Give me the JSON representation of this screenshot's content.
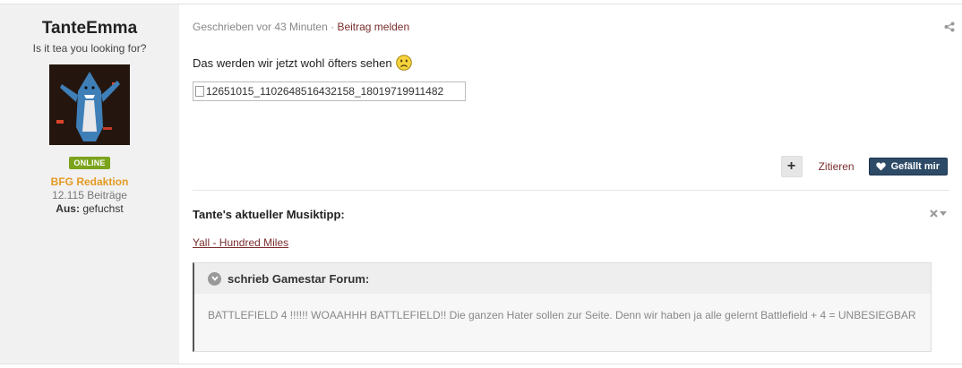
{
  "user": {
    "name": "TanteEmma",
    "title": "Is it tea you looking for?",
    "online_label": "ONLINE",
    "rank": "BFG Redaktion",
    "post_count": "12.115 Beiträge",
    "location_label": "Aus:",
    "location_value": "gefuchst"
  },
  "post": {
    "meta_written": "Geschrieben vor 43 Minuten",
    "meta_separator": "·",
    "report_label": "Beitrag melden",
    "message": "Das werden wir jetzt wohl öfters sehen",
    "image_alt": "12651015_1102648516432158_18019719911482",
    "share_icon": "share-icon",
    "smiley_icon": "sad-smiley-icon"
  },
  "actions": {
    "plus_label": "+",
    "quote_label": "Zitieren",
    "like_label": "Gefällt mir"
  },
  "signature": {
    "title": "Tante's aktueller Musiktipp:",
    "link_text": "Yall - Hundred Miles",
    "quote_header": "schrieb Gamestar Forum:",
    "quote_text": "BATTLEFIELD 4 !!!!!! WOAAHHH BATTLEFIELD!! Die ganzen Hater sollen zur Seite. Denn wir haben ja alle gelernt Battlefield + 4 = UNBESIEGBAR"
  },
  "colors": {
    "sidebar_bg": "#f1f1f1",
    "online_green": "#7ba31b",
    "rank_orange": "#e49a22",
    "link_red": "#7a2d2d",
    "like_blue": "#2d4a66"
  }
}
